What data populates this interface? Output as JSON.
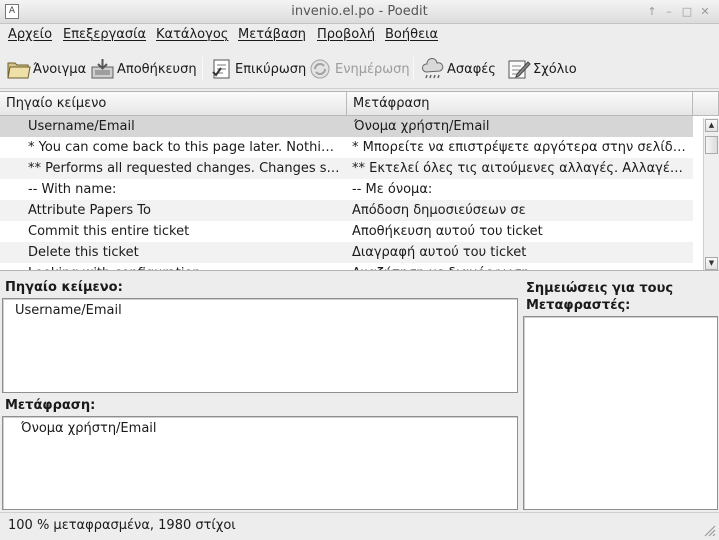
{
  "window": {
    "title": "invenio.el.po - Poedit"
  },
  "menu": [
    "Αρχείο",
    "Επεξεργασία",
    "Κατάλογος",
    "Μετάβαση",
    "Προβολή",
    "Βοήθεια"
  ],
  "toolbar": {
    "open": "Άνοιγμα",
    "save": "Αποθήκευση",
    "validate": "Επικύρωση",
    "update": "Ενημέρωση",
    "fuzzy": "Ασαφές",
    "comment": "Σχόλιο"
  },
  "columns": {
    "source": "Πηγαίο κείμενο",
    "translation": "Μετάφραση"
  },
  "rows": [
    {
      "source": "    Username/Email",
      "translation": "  Όνομα χρήστη/Email"
    },
    {
      "source": "   * You can come back to this page later. Nothing will be lost.",
      "translation": "* Μπορείτε να επιστρέψετε αργότερα στην σελίδα αυτή."
    },
    {
      "source": "   ** Performs all requested changes. Changes subject to review.",
      "translation": " ** Εκτελεί όλες τις αιτούμενες αλλαγές. Αλλαγές υπό έλεγχο."
    },
    {
      "source": "--  With name:",
      "translation": "-- Με όνομα:"
    },
    {
      "source": "Attribute Papers To",
      "translation": "Απόδοση δημοσιεύσεων σε"
    },
    {
      "source": "Commit this entire ticket",
      "translation": "Αποθήκευση αυτού του ticket"
    },
    {
      "source": "Delete this ticket",
      "translation": "Διαγραφή αυτού του ticket"
    },
    {
      "source": "Looking with configuration",
      "translation": "Αναζήτηση με διαμόρφωση"
    }
  ],
  "panels": {
    "source_label": "Πηγαίο κείμενο:",
    "source_text": "Username/Email",
    "translation_label": "Μετάφραση:",
    "translation_text": "Όνομα χρήστη/Email",
    "notes_label_line1": "Σημειώσεις για τους",
    "notes_label_line2": "Μεταφραστές:"
  },
  "status": {
    "text": "100 % μεταφρασμένα, 1980 στίχοι"
  }
}
